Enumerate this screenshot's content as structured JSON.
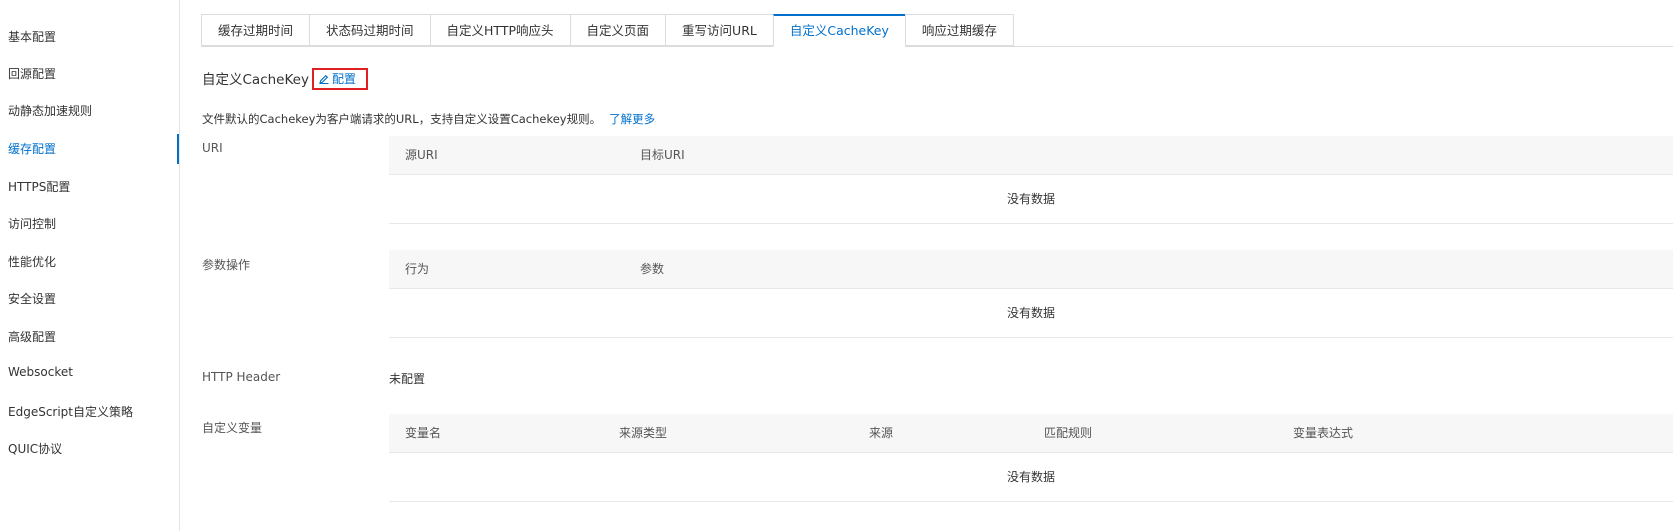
{
  "sidebar": {
    "items": [
      {
        "label": "基本配置"
      },
      {
        "label": "回源配置"
      },
      {
        "label": "动静态加速规则"
      },
      {
        "label": "缓存配置"
      },
      {
        "label": "HTTPS配置"
      },
      {
        "label": "访问控制"
      },
      {
        "label": "性能优化"
      },
      {
        "label": "安全设置"
      },
      {
        "label": "高级配置"
      },
      {
        "label": "Websocket"
      },
      {
        "label": "EdgeScript自定义策略"
      },
      {
        "label": "QUIC协议"
      }
    ],
    "active_index": 3
  },
  "tabs": [
    {
      "label": "缓存过期时间"
    },
    {
      "label": "状态码过期时间"
    },
    {
      "label": "自定义HTTP响应头"
    },
    {
      "label": "自定义页面"
    },
    {
      "label": "重写访问URL"
    },
    {
      "label": "自定义CacheKey"
    },
    {
      "label": "响应过期缓存"
    }
  ],
  "section": {
    "title": "自定义CacheKey",
    "config_button": "配置",
    "description": "文件默认的Cachekey为客户端请求的URL，支持自定义设置Cachekey规则。",
    "learn_more": "了解更多"
  },
  "uri": {
    "label": "URI",
    "columns": [
      "源URI",
      "目标URI"
    ],
    "empty": "没有数据"
  },
  "params": {
    "label": "参数操作",
    "columns": [
      "行为",
      "参数"
    ],
    "empty": "没有数据"
  },
  "http_header": {
    "label": "HTTP Header",
    "value": "未配置"
  },
  "custom_vars": {
    "label": "自定义变量",
    "columns": [
      "变量名",
      "来源类型",
      "来源",
      "匹配规则",
      "变量表达式"
    ],
    "empty": "没有数据"
  },
  "colors": {
    "accent": "#0070cc",
    "highlight_border": "#e02020"
  }
}
